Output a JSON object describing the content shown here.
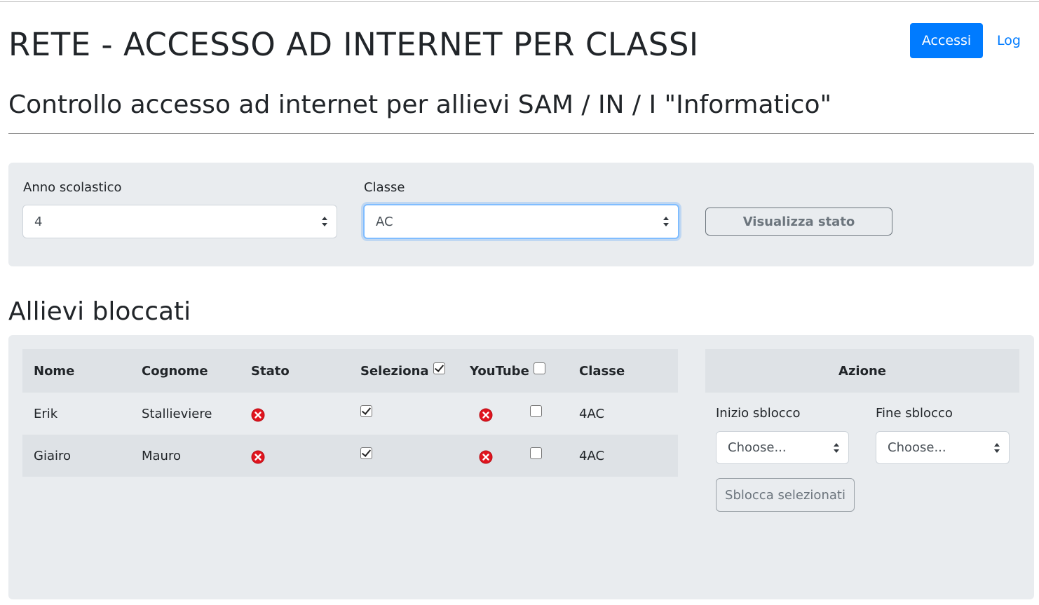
{
  "header": {
    "title": "RETE - ACCESSO AD INTERNET PER CLASSI",
    "nav": {
      "accessi_label": "Accessi",
      "log_label": "Log"
    }
  },
  "subtitle": "Controllo accesso ad internet per allievi SAM / IN / I \"Informatico\"",
  "filters": {
    "anno_label": "Anno scolastico",
    "anno_value": "4",
    "classe_label": "Classe",
    "classe_value": "AC",
    "visualizza_label": "Visualizza stato"
  },
  "blocked": {
    "title": "Allievi bloccati",
    "columns": [
      "Nome",
      "Cognome",
      "Stato",
      "Seleziona",
      "YouTube",
      "Classe"
    ],
    "rows": [
      {
        "nome": "Erik",
        "cognome": "Stallieviere",
        "stato": "blocked",
        "seleziona": true,
        "youtube_status": "blocked",
        "youtube": false,
        "classe": "4AC"
      },
      {
        "nome": "Giairo",
        "cognome": "Mauro",
        "stato": "blocked",
        "seleziona": true,
        "youtube_status": "blocked",
        "youtube": false,
        "classe": "4AC"
      }
    ],
    "header_checks": {
      "seleziona": true,
      "youtube": false
    }
  },
  "azione": {
    "title": "Azione",
    "inizio_label": "Inizio sblocco",
    "inizio_value": "Choose...",
    "fine_label": "Fine sblocco",
    "fine_value": "Choose...",
    "sblocca_label": "Sblocca selezionati"
  },
  "colors": {
    "primary": "#007bff",
    "panel": "#e9ecef",
    "table_head": "#dee2e6",
    "blocked_icon": "#e0141e"
  },
  "icons": {
    "status_blocked": "x-circle-icon",
    "select_arrows": "sort-arrows-icon"
  }
}
